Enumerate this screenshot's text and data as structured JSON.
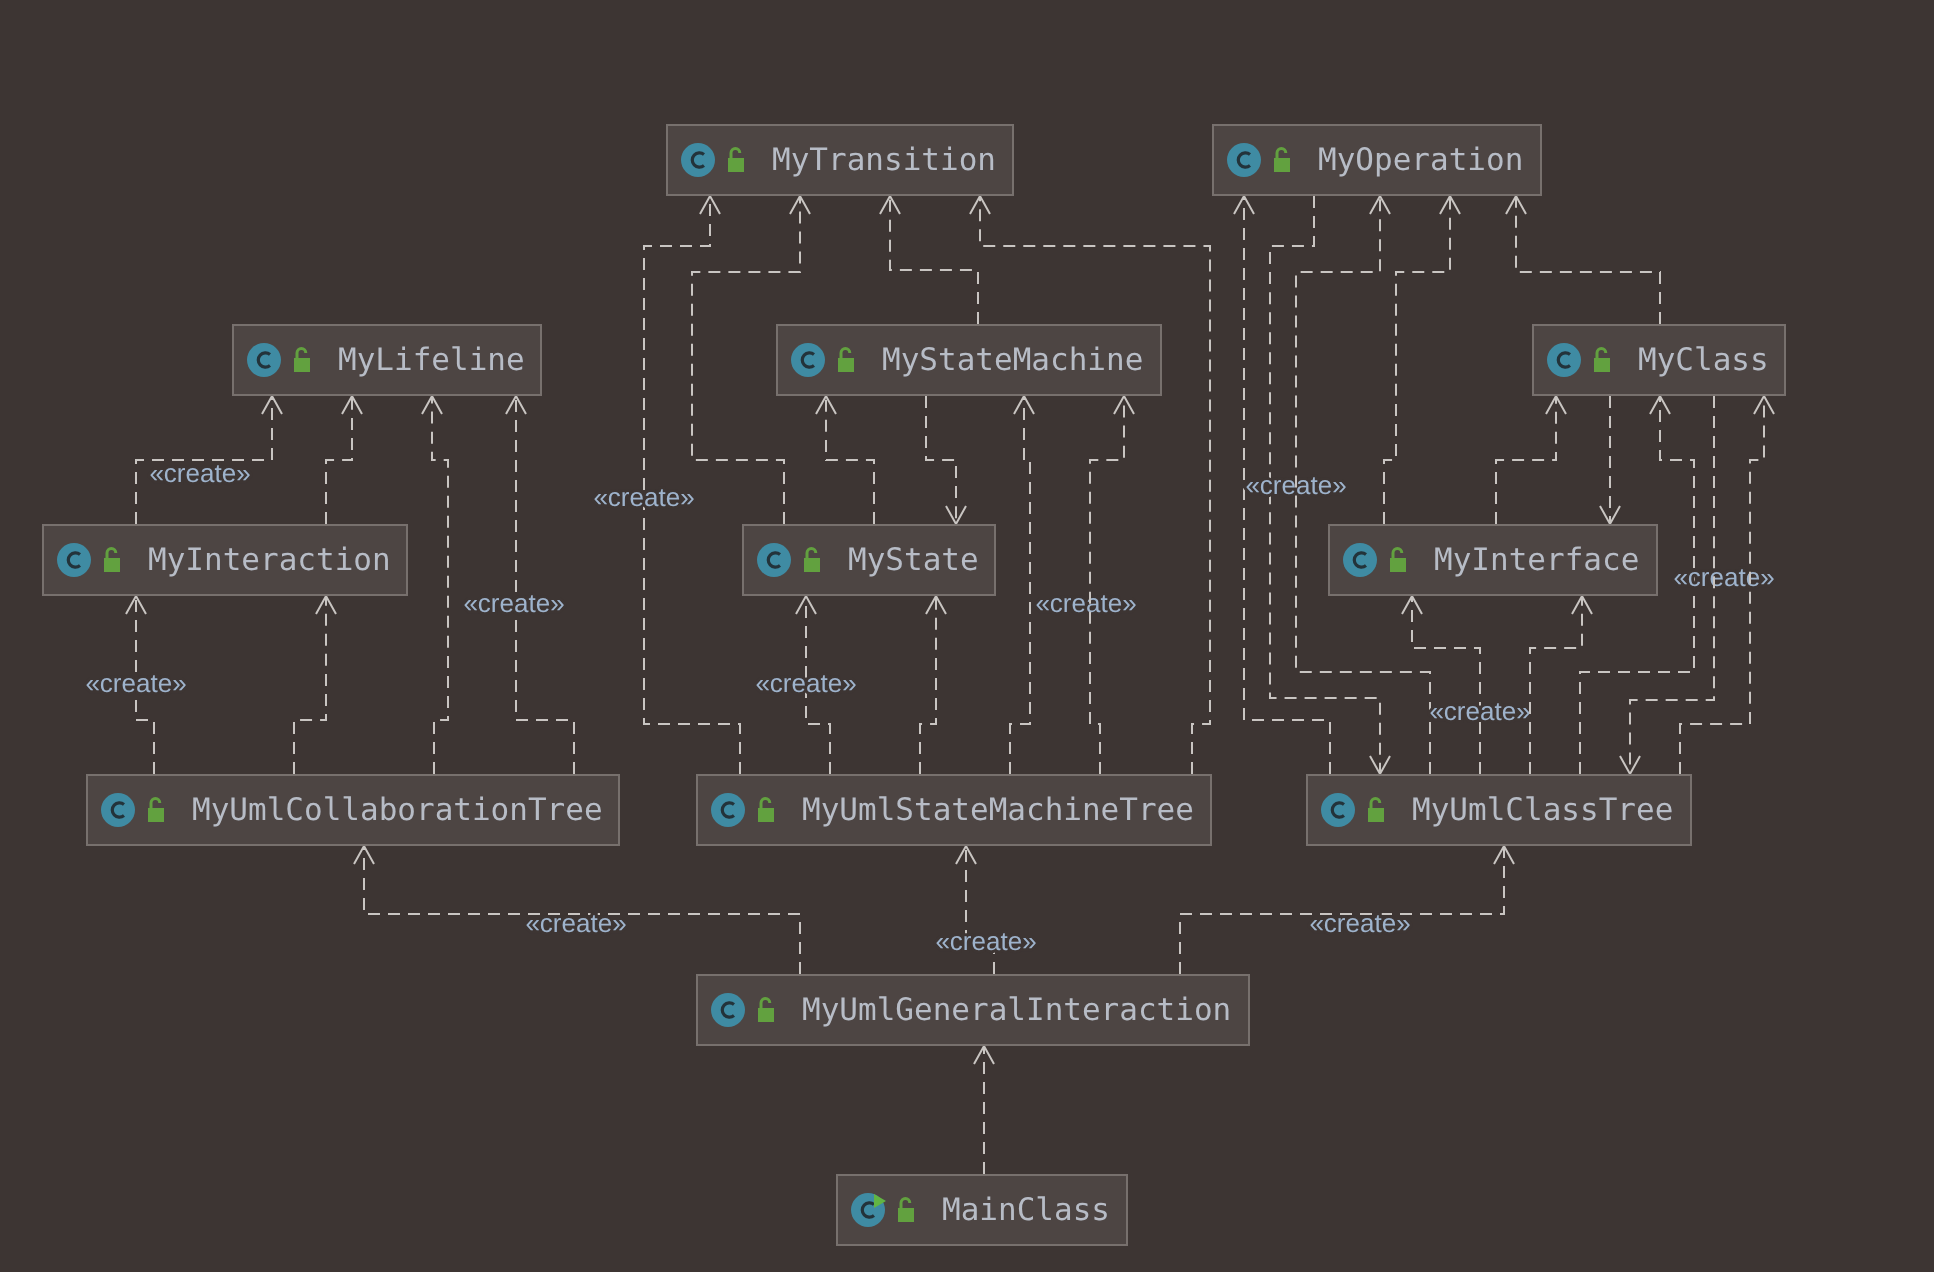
{
  "diagram": {
    "nodes": [
      {
        "name": "MyTransition",
        "kind": "class"
      },
      {
        "name": "MyOperation",
        "kind": "class"
      },
      {
        "name": "MyLifeline",
        "kind": "class"
      },
      {
        "name": "MyStateMachine",
        "kind": "class"
      },
      {
        "name": "MyClass",
        "kind": "class"
      },
      {
        "name": "MyInteraction",
        "kind": "class"
      },
      {
        "name": "MyState",
        "kind": "class"
      },
      {
        "name": "MyInterface",
        "kind": "class"
      },
      {
        "name": "MyUmlCollaborationTree",
        "kind": "class"
      },
      {
        "name": "MyUmlStateMachineTree",
        "kind": "class"
      },
      {
        "name": "MyUmlClassTree",
        "kind": "class"
      },
      {
        "name": "MyUmlGeneralInteraction",
        "kind": "class"
      },
      {
        "name": "MainClass",
        "kind": "main"
      }
    ],
    "edges": [
      {
        "kind": "create",
        "label": "«create»"
      },
      {
        "kind": "use"
      },
      {
        "kind": "create",
        "label": "«create»"
      },
      {
        "kind": "use"
      },
      {
        "kind": "use"
      },
      {
        "kind": "create",
        "label": "«create»"
      },
      {
        "kind": "create",
        "label": "«create»"
      },
      {
        "kind": "use"
      },
      {
        "kind": "use"
      },
      {
        "kind": "use"
      },
      {
        "kind": "use"
      },
      {
        "kind": "use"
      },
      {
        "kind": "create",
        "label": "«create»"
      },
      {
        "kind": "use"
      },
      {
        "kind": "create",
        "label": "«create»"
      },
      {
        "kind": "use"
      },
      {
        "kind": "use"
      },
      {
        "kind": "create",
        "label": "«create»"
      },
      {
        "kind": "use"
      },
      {
        "kind": "use"
      },
      {
        "kind": "use"
      },
      {
        "kind": "use"
      },
      {
        "kind": "use"
      },
      {
        "kind": "create",
        "label": "«create»"
      },
      {
        "kind": "use"
      },
      {
        "kind": "use"
      },
      {
        "kind": "create",
        "label": "«create»"
      },
      {
        "kind": "use"
      },
      {
        "kind": "create",
        "label": "«create»"
      },
      {
        "kind": "create",
        "label": "«create»"
      },
      {
        "kind": "create",
        "label": "«create»"
      },
      {
        "kind": "use"
      }
    ]
  }
}
